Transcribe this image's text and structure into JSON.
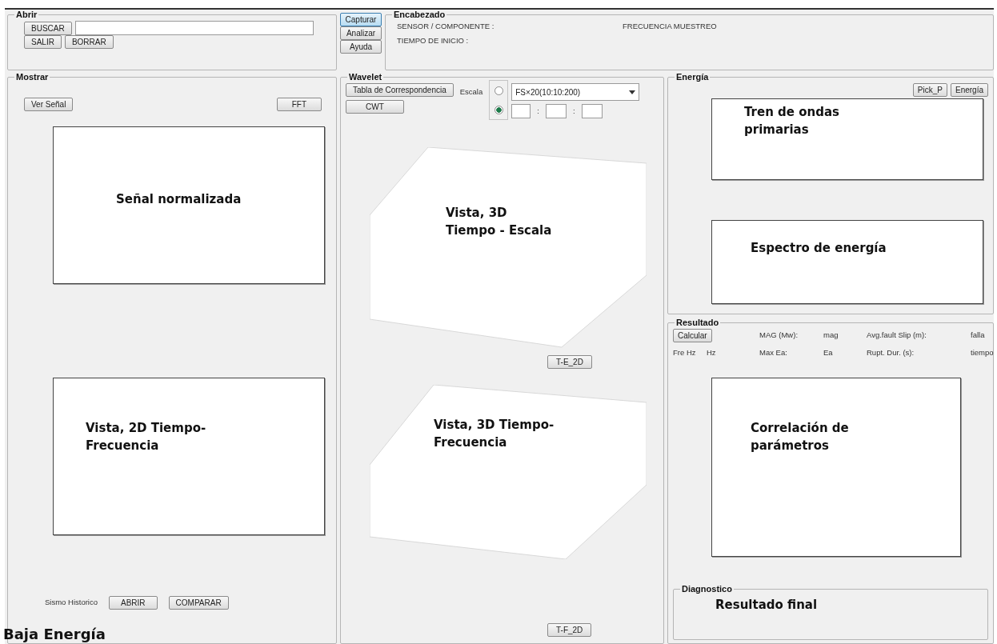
{
  "abrir": {
    "title": "Abrir",
    "search_button": "BUSCAR",
    "exit_button": "SALIR",
    "clear_button": "BORRAR"
  },
  "actions": [
    {
      "label": "Capturar",
      "selected": true
    },
    {
      "label": "Analizar",
      "selected": false
    },
    {
      "label": "Ayuda",
      "selected": false
    }
  ],
  "encabezado": {
    "title": "Encabezado",
    "sensor_label": "SENSOR / COMPONENTE :",
    "start_label": "TIEMPO DE INICIO :",
    "frequency_label": "FRECUENCIA MUESTREO"
  },
  "mostrar": {
    "title": "Mostrar",
    "signal_button": "Ver Señal",
    "fft_button": "FFT",
    "plots": [
      "Señal normalizada",
      "Vista, 2D Tiempo-Frecuencia"
    ],
    "history_label": "Sismo Historico",
    "open_button": "ABRIR",
    "compare_button": "COMPARAR"
  },
  "wavelet": {
    "title": "Wavelet",
    "table_button": "Tabla de Correspondencia",
    "cwt_button": "CWT",
    "scale_label": "Escala",
    "radios": [
      {
        "selected": false
      },
      {
        "selected": true
      }
    ],
    "scale_select": "FS×20(10:10:200)",
    "separators": [
      ":",
      ":"
    ],
    "plots": [
      {
        "lines": [
          "Vista, 3D",
          "Tiempo - Escala"
        ],
        "button": "T-E_2D"
      },
      {
        "lines": [
          "Vista, 3D Tiempo-",
          "Frecuencia"
        ],
        "button": "T-F_2D"
      }
    ]
  },
  "energia": {
    "title": "Energía",
    "buttons": [
      "Pick_P",
      "Energía"
    ],
    "plots": [
      "Tren de ondas primarias",
      "Espectro de energía"
    ]
  },
  "resultado": {
    "title": "Resultado",
    "calc_button": "Calcular",
    "row_1": [
      "MAG (Mw):",
      "mag",
      "Avg.fault Slip (m):",
      "falla"
    ],
    "row_2": [
      "Fre Hz",
      "Hz",
      "Max Ea:",
      "Ea",
      "Rupt. Dur. (s):",
      "tiempo"
    ],
    "plot": "Correlación de parámetros"
  },
  "diagnostico": {
    "title": "Diagnostico",
    "text": "Resultado final"
  },
  "footer_label": "Baja Energía"
}
